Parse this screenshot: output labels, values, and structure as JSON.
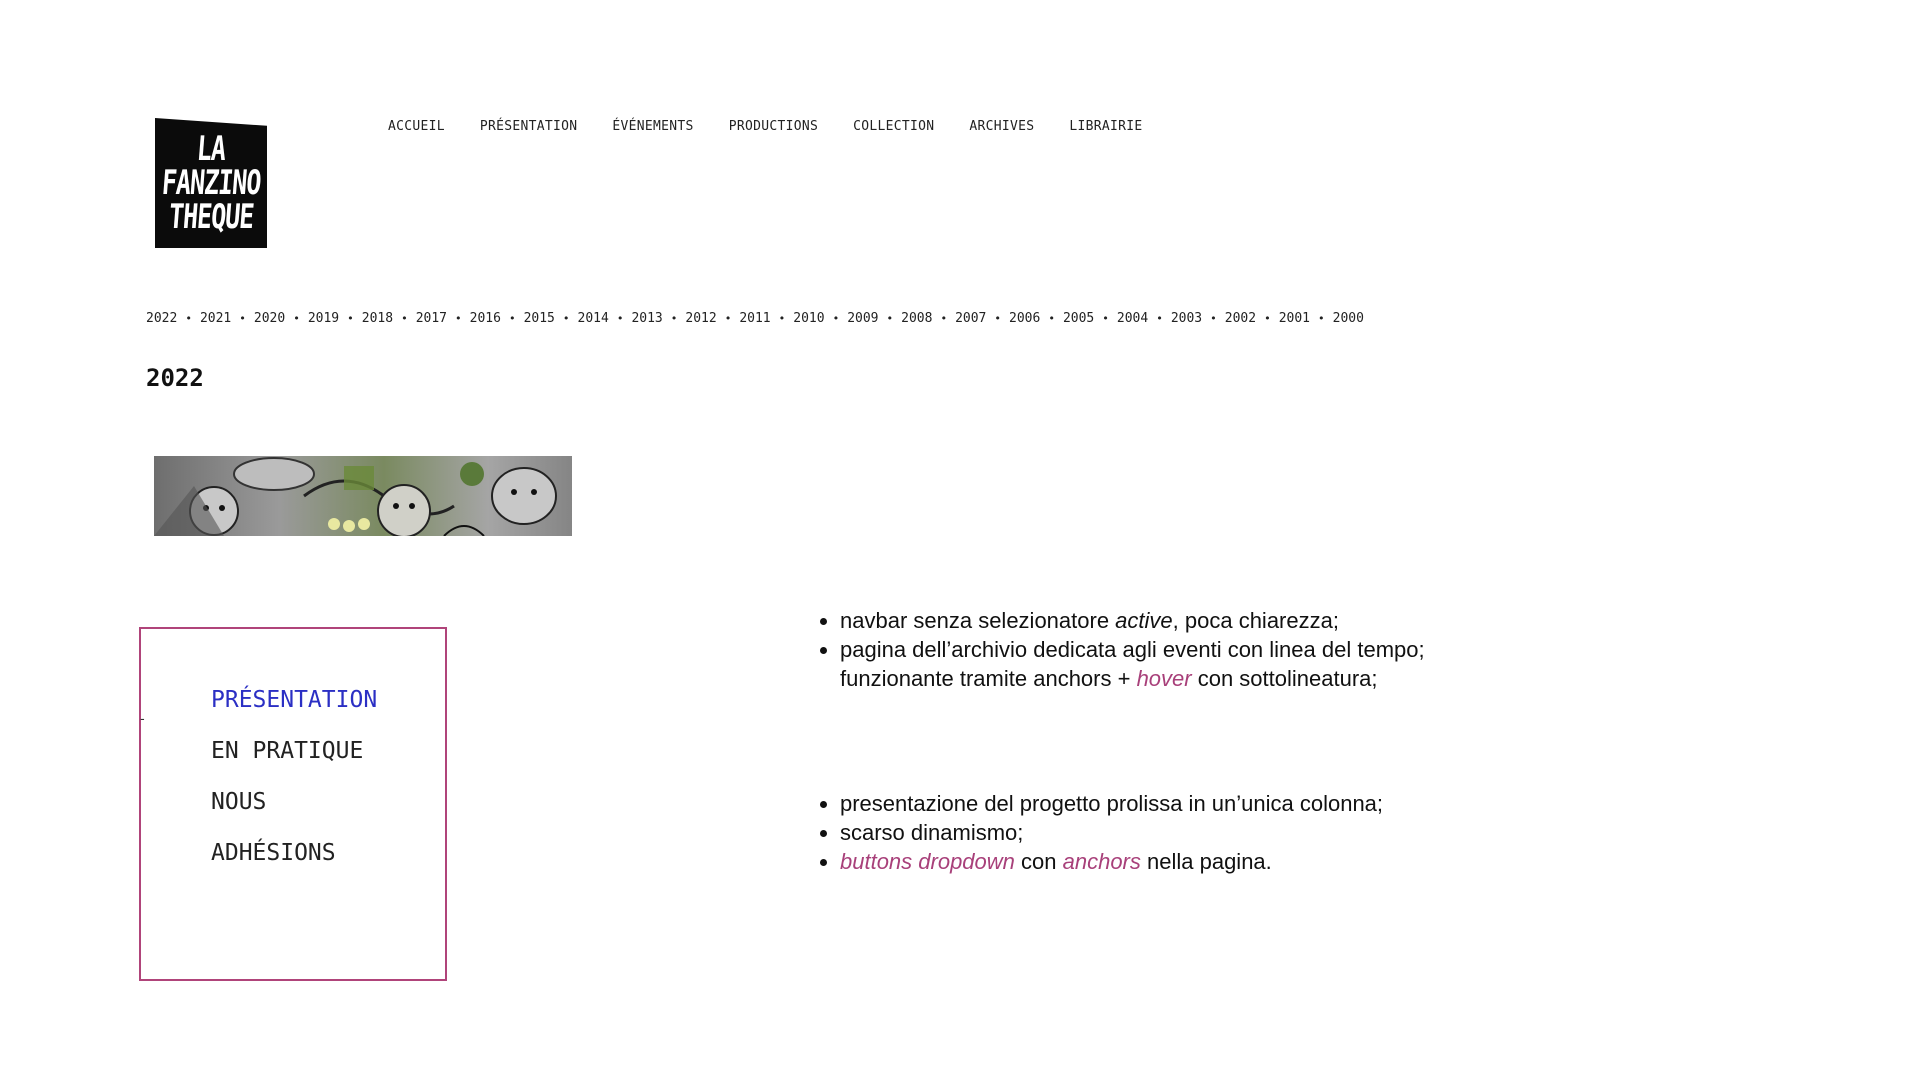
{
  "logo": {
    "lines": [
      "LA",
      "FANZINO",
      "THEQUE"
    ]
  },
  "nav": [
    "ACCUEIL",
    "PRÉSENTATION",
    "ÉVÉNEMENTS",
    "PRODUCTIONS",
    "COLLECTION",
    "ARCHIVES",
    "LIBRAIRIE"
  ],
  "years": [
    "2022",
    "2021",
    "2020",
    "2019",
    "2018",
    "2017",
    "2016",
    "2015",
    "2014",
    "2013",
    "2012",
    "2011",
    "2010",
    "2009",
    "2008",
    "2007",
    "2006",
    "2005",
    "2004",
    "2003",
    "2002",
    "2001",
    "2000"
  ],
  "year_separator": "•",
  "year_title": "2022",
  "inset": {
    "tick": "-",
    "items": [
      "PRÉSENTATION",
      "EN PRATIQUE",
      "NOUS",
      "ADHÉSIONS"
    ],
    "active_color": "#2b2fc4",
    "border_color": "#b0447a"
  },
  "notes": {
    "group1": {
      "item1": {
        "a": "navbar senza selezionatore ",
        "em": "active",
        "b": ", poca chiarezza;"
      },
      "item2": {
        "a": "pagina dell’archivio dedicata agli eventi con linea del tempo;",
        "b": "funzionante tramite anchors + ",
        "accent": "hover",
        "c": " con sottolineatura;"
      }
    },
    "group2": {
      "item1": "presentazione del progetto prolissa in un’unica colonna;",
      "item2": "scarso dinamismo;",
      "item3": {
        "accent1": "buttons dropdown",
        "mid": " con ",
        "accent2": "anchors",
        "end": " nella pagina."
      }
    },
    "accent_color": "#a8407a"
  }
}
